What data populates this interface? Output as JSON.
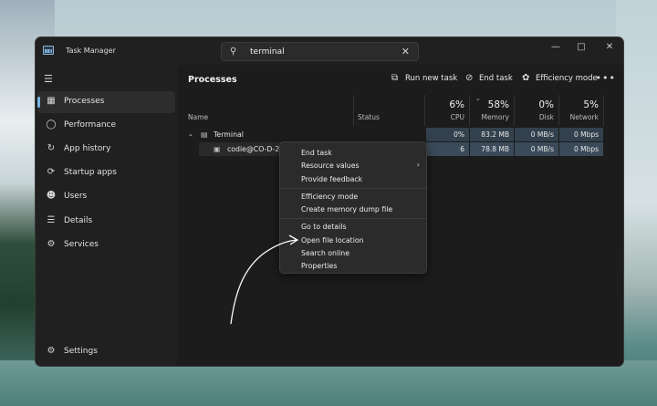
{
  "window": {
    "title": "Task Manager",
    "search_value": "terminal",
    "controls": [
      "minimize",
      "maximize",
      "close"
    ]
  },
  "sidebar": {
    "items": [
      {
        "label": "Processes",
        "icon": "processes-icon",
        "active": true
      },
      {
        "label": "Performance",
        "icon": "performance-icon"
      },
      {
        "label": "App history",
        "icon": "history-icon"
      },
      {
        "label": "Startup apps",
        "icon": "startup-icon"
      },
      {
        "label": "Users",
        "icon": "users-icon"
      },
      {
        "label": "Details",
        "icon": "details-icon"
      },
      {
        "label": "Services",
        "icon": "services-icon"
      }
    ],
    "settings_label": "Settings"
  },
  "main": {
    "title": "Processes",
    "toolbar": {
      "run_new_task": "Run new task",
      "end_task": "End task",
      "efficiency_mode": "Efficiency mode"
    },
    "columns": {
      "name": "Name",
      "status": "Status",
      "cpu": {
        "pct": "6%",
        "label": "CPU"
      },
      "memory": {
        "pct": "58%",
        "label": "Memory"
      },
      "disk": {
        "pct": "0%",
        "label": "Disk"
      },
      "network": {
        "pct": "5%",
        "label": "Network"
      }
    },
    "rows": [
      {
        "name": "Terminal",
        "cpu": "0%",
        "memory": "83.2 MB",
        "disk": "0 MB/s",
        "network": "0 Mbps"
      },
      {
        "name": "codie@CO-D-2N",
        "cpu": "6",
        "memory": "78.8 MB",
        "disk": "0 MB/s",
        "network": "0 Mbps"
      }
    ]
  },
  "context_menu": {
    "items": [
      "End task",
      "Resource values",
      "Provide feedback",
      "Efficiency mode",
      "Create memory dump file",
      "Go to details",
      "Open file location",
      "Search online",
      "Properties"
    ]
  },
  "colors": {
    "accent": "#78b4e6",
    "window_bg": "#202020",
    "highlight": "#3a4a59"
  }
}
